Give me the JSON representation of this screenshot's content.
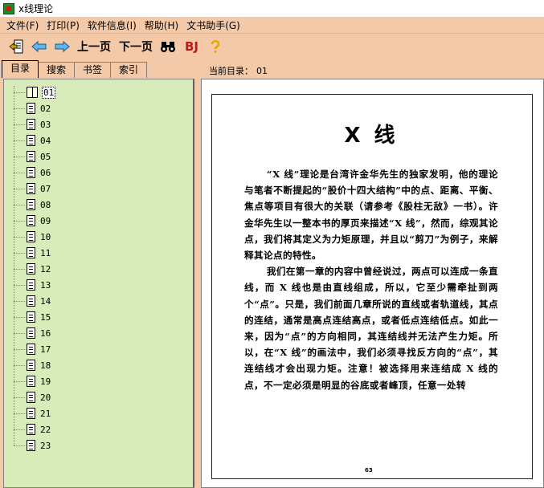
{
  "window": {
    "title": "x线理论"
  },
  "menu": {
    "items": [
      {
        "label": "文件(F)"
      },
      {
        "label": "打印(P)"
      },
      {
        "label": "软件信息(I)"
      },
      {
        "label": "帮助(H)"
      },
      {
        "label": "文书助手(G)"
      }
    ]
  },
  "toolbar": {
    "prev_label": "上一页",
    "next_label": "下一页",
    "bj_label": "BJ",
    "icons": [
      "exit-icon",
      "back-arrow-icon",
      "forward-arrow-icon",
      "binoculars-icon",
      "help-icon"
    ]
  },
  "tabs": [
    {
      "label": "目录",
      "active": true
    },
    {
      "label": "搜索",
      "active": false
    },
    {
      "label": "书签",
      "active": false
    },
    {
      "label": "索引",
      "active": false
    }
  ],
  "tree": {
    "items": [
      "01",
      "02",
      "03",
      "04",
      "05",
      "06",
      "07",
      "08",
      "09",
      "10",
      "11",
      "12",
      "13",
      "14",
      "15",
      "16",
      "17",
      "18",
      "19",
      "20",
      "21",
      "22",
      "23"
    ],
    "selected": "01"
  },
  "current_dir": {
    "label": "当前目录：",
    "value": "01"
  },
  "document": {
    "title": "X 线",
    "paragraphs": [
      "“X 线”理论是台湾许金华先生的独家发明，他的理论与笔者不断提起的“股价十四大结构”中的点、距离、平衡、焦点等项目有很大的关联（请参考《股柱无敌》一书）。许金华先生以一整本书的厚页来描述“X 线”，然而，综观其论点，我们将其定义为力矩原理，并且以“剪刀”为例子，来解释其论点的特性。",
      "我们在第一章的内容中曾经说过，两点可以连成一条直线，而 X 线也是由直线组成，所以，它至少需牵扯到两个“点”。只是，我们前面几章所说的直线或者轨道线，其点的连结，通常是高点连结高点，或者低点连结低点。如此一来，因为“点”的方向相同，其连结线并无法产生力矩。所以，在“X 线”的画法中，我们必须寻找反方向的“点”，其连结线才会出现力矩。注意！被选择用来连结成 X 线的点，不一定必须是明显的谷底或者峰顶，任意一处转"
    ],
    "page_number": "63"
  }
}
